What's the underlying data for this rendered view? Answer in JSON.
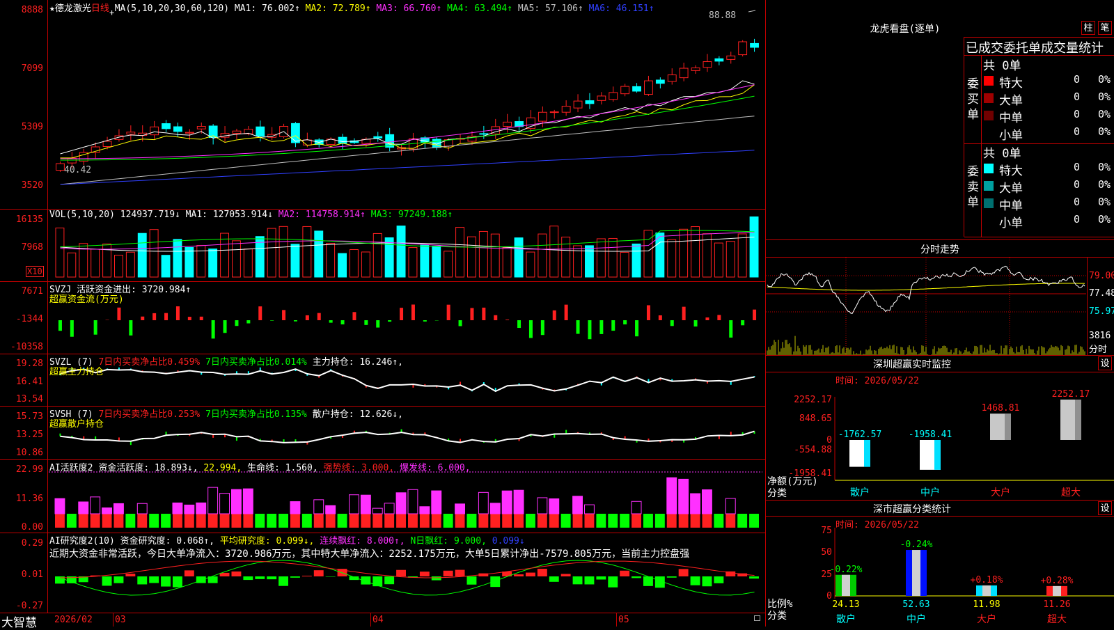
{
  "main": {
    "star": "★",
    "name": "德龙激光",
    "period": "日线",
    "ma_title": "MA(5,10,20,30,60,120)",
    "ma": [
      {
        "k": "MA1:",
        "v": "76.002↑",
        "color": "#ffffff"
      },
      {
        "k": "MA2:",
        "v": "72.789↑",
        "color": "#ffff00"
      },
      {
        "k": "MA3:",
        "v": "66.760↑",
        "color": "#ff30ff"
      },
      {
        "k": "MA4:",
        "v": "63.494↑",
        "color": "#00ff00"
      },
      {
        "k": "MA5:",
        "v": "57.106↑",
        "color": "#c0c0c0"
      },
      {
        "k": "MA6:",
        "v": "46.151↑",
        "color": "#3040ff"
      }
    ],
    "y_labels": [
      "8888",
      "7099",
      "5309",
      "3520"
    ],
    "high_marker": "88.88",
    "low_marker": "40.42"
  },
  "vol": {
    "title": "VOL(5,10,20)",
    "value": "124937.719↓",
    "ma1": "MA1: 127053.914↓",
    "ma2": "MA2: 114758.914↑",
    "ma3": "MA3: 97249.188↑",
    "y_labels": [
      "16135",
      "7968"
    ],
    "unit": "X10"
  },
  "svzj": {
    "title": "SVZJ",
    "desc": "活跃资金进出: 3720.984↑",
    "sub": "超赢资金流(万元)",
    "y_labels": [
      "7671",
      "-1344",
      "-10358"
    ]
  },
  "svzl": {
    "title": "SVZL (7)",
    "t1": "7日内买卖净占比0.459%",
    "t2": "7日内买卖净占比0.014%",
    "t3": "主力持仓: 16.246↑,",
    "sub": "超赢主力持仓",
    "y_labels": [
      "19.28",
      "16.41",
      "13.54"
    ]
  },
  "svsh": {
    "title": "SVSH (7)",
    "t1": "7日内买卖净占比0.253%",
    "t2": "7日内买卖净占比0.135%",
    "t3": "散户持仓: 12.626↓,",
    "sub": "超赢散户持仓",
    "y_labels": [
      "15.73",
      "13.25",
      "10.86"
    ]
  },
  "ai1": {
    "title": "AI活跃度2",
    "t1": "资金活跃度: 18.893↓,",
    "t2": "22.994,",
    "t3": "生命线: 1.560,",
    "t4": "强势线: 3.000,",
    "t5": "爆发线: 6.000,",
    "y_labels": [
      "22.99",
      "11.36",
      "0.00"
    ]
  },
  "ai2": {
    "title": "AI研究度2(10)",
    "t1": "资金研究度: 0.068↑,",
    "t2": "平均研究度: 0.099↓,",
    "t3": "连续飘红: 8.000↑,",
    "t4": "N日飘红: 9.000,",
    "t5": "0.099↓",
    "summary": "近期大资金非常活跃，今日大单净流入：3720.986万元，其中特大单净流入：2252.175万元，大单5日累计净出-7579.805万元，当前主力控盘强",
    "y_labels": [
      "0.29",
      "0.01",
      "-0.27"
    ]
  },
  "bottom": {
    "brand": "大智慧",
    "dates": [
      "2026/02",
      "03",
      "04",
      "05"
    ]
  },
  "longhu": {
    "title": "龙虎看盘(逐单)",
    "btn1": "柱",
    "btn2": "笔",
    "header": "已成交委托单成交量统计",
    "buy_label": "委买单",
    "sell_label": "委卖单",
    "buy_total": "共 0单",
    "sell_total": "共 0单",
    "buy_rows": [
      {
        "name": "特大",
        "n": "0",
        "p": "0%",
        "color": "#ff0000"
      },
      {
        "name": "大单",
        "n": "0",
        "p": "0%",
        "color": "#a00000"
      },
      {
        "name": "中单",
        "n": "0",
        "p": "0%",
        "color": "#700000"
      },
      {
        "name": "小单",
        "n": "0",
        "p": "0%",
        "color": "#000000"
      }
    ],
    "sell_rows": [
      {
        "name": "特大",
        "n": "0",
        "p": "0%",
        "color": "#00ffff"
      },
      {
        "name": "大单",
        "n": "0",
        "p": "0%",
        "color": "#00a0a0"
      },
      {
        "name": "中单",
        "n": "0",
        "p": "0%",
        "color": "#007070"
      },
      {
        "name": "小单",
        "n": "0",
        "p": "0%",
        "color": "#000000"
      }
    ]
  },
  "fenshi": {
    "title": "分时走势",
    "y_labels": [
      "79.00",
      "77.48",
      "75.97"
    ],
    "vol_label": "3816",
    "vol_sub": "分时"
  },
  "monitor": {
    "title": "深圳超赢实时监控",
    "btn": "设",
    "time": "时间: 2026/05/22",
    "y_labels": [
      "2252.17",
      "848.65",
      "0",
      "-554.88",
      "-1958.41"
    ],
    "ylabel": "净额(万元)",
    "xlabel": "分类",
    "cats": [
      "散户",
      "中户",
      "大户",
      "超大"
    ],
    "values": [
      "-1762.57",
      "-1958.41",
      "1468.81",
      "2252.17"
    ],
    "nums": [
      -1762.57,
      -1958.41,
      1468.81,
      2252.17
    ]
  },
  "classify": {
    "title": "深市超赢分类统计",
    "btn": "设",
    "time": "时间: 2026/05/22",
    "y_labels": [
      "75",
      "50",
      "25",
      "0"
    ],
    "ylabel": "比例%",
    "xlabel": "分类",
    "cats": [
      "散户",
      "中户",
      "大户",
      "超大"
    ],
    "changes": [
      "-0.22%",
      "-0.24%",
      "+0.18%",
      "+0.28%"
    ],
    "values": [
      "24.13",
      "52.63",
      "11.98",
      "11.26"
    ],
    "nums": [
      24.13,
      52.63,
      11.98,
      11.26
    ]
  }
}
